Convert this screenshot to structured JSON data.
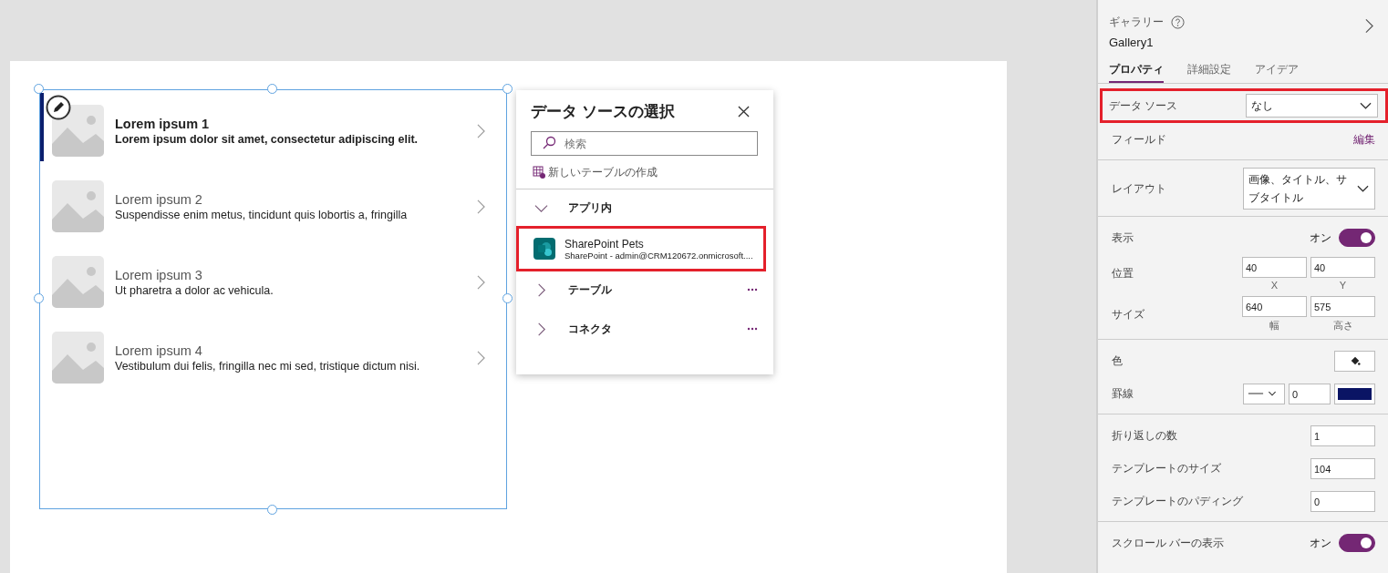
{
  "gallery": {
    "items": [
      {
        "title": "Lorem ipsum 1",
        "subtitle": "Lorem ipsum dolor sit amet, consectetur adipiscing elit.",
        "selected": true
      },
      {
        "title": "Lorem ipsum 2",
        "subtitle": "Suspendisse enim metus, tincidunt quis lobortis a, fringilla",
        "selected": false
      },
      {
        "title": "Lorem ipsum 3",
        "subtitle": "Ut pharetra a dolor ac vehicula.",
        "selected": false
      },
      {
        "title": "Lorem ipsum 4",
        "subtitle": "Vestibulum dui felis, fringilla nec mi sed, tristique dictum nisi.",
        "selected": false
      }
    ]
  },
  "flyout": {
    "title": "データ ソースの選択",
    "search": {
      "placeholder": "検索"
    },
    "new_table": "新しいテーブルの作成",
    "groups": [
      {
        "label": "アプリ内",
        "expanded": true,
        "children": [
          {
            "name": "SharePoint Pets",
            "detail": "SharePoint - admin@CRM120672.onmicrosoft....",
            "highlighted": true
          }
        ]
      },
      {
        "label": "テーブル",
        "expanded": false
      },
      {
        "label": "コネクタ",
        "expanded": false
      }
    ]
  },
  "panel": {
    "type_label": "ギャラリー",
    "name": "Gallery1",
    "tabs": [
      {
        "label": "プロパティ",
        "selected": true
      },
      {
        "label": "詳細設定",
        "selected": false
      },
      {
        "label": "アイデア",
        "selected": false
      }
    ],
    "sections": [
      [
        {
          "kind": "dropdown",
          "label": "データ ソース",
          "value": "なし",
          "highlighted": true
        },
        {
          "kind": "link",
          "label": "フィールド",
          "value": "編集"
        }
      ],
      [
        {
          "kind": "dropdown",
          "label": "レイアウト",
          "value": "画像、タイトル、サブタイトル",
          "highlighted": false
        }
      ],
      [
        {
          "kind": "toggle",
          "label": "表示",
          "value": "オン",
          "on": true
        },
        {
          "kind": "pair",
          "label": "位置",
          "values": [
            "40",
            "40"
          ],
          "captions": [
            "X",
            "Y"
          ]
        },
        {
          "kind": "pair",
          "label": "サイズ",
          "values": [
            "640",
            "575"
          ],
          "captions": [
            "幅",
            "高さ"
          ]
        }
      ],
      [
        {
          "kind": "color",
          "label": "色"
        },
        {
          "kind": "border",
          "label": "罫線",
          "value": "0",
          "color": "#0a1464"
        }
      ],
      [
        {
          "kind": "number",
          "label": "折り返しの数",
          "value": "1"
        },
        {
          "kind": "number",
          "label": "テンプレートのサイズ",
          "value": "104"
        },
        {
          "kind": "number",
          "label": "テンプレートのパディング",
          "value": "0"
        }
      ],
      [
        {
          "kind": "toggle",
          "label": "スクロール バーの表示",
          "value": "オン",
          "on": true
        }
      ]
    ]
  }
}
